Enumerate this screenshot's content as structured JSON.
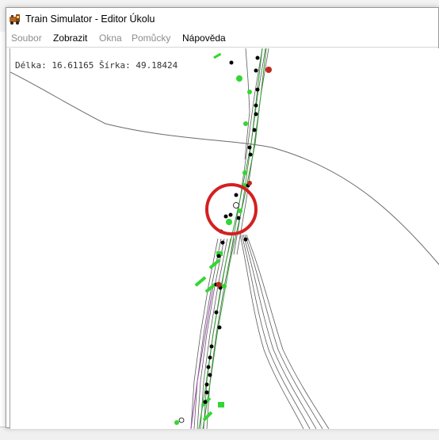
{
  "window": {
    "title": "Train Simulator - Editor Úkolu",
    "icon": "train-simulator-app-icon"
  },
  "menu": {
    "items": [
      {
        "label": "Soubor",
        "enabled": false
      },
      {
        "label": "Zobrazit",
        "enabled": true
      },
      {
        "label": "Okna",
        "enabled": false
      },
      {
        "label": "Pomůcky",
        "enabled": false
      },
      {
        "label": "Nápověda",
        "enabled": true
      }
    ]
  },
  "map": {
    "coordinates_text": "Délka: 16.61165 Šírka: 49.18424",
    "colors": {
      "track": "#5a5a5a",
      "route": "#2aa02a",
      "marker_green": "#33d633",
      "marker_black": "#000000",
      "marker_red": "#c0281e",
      "highlight_circle": "#d42020",
      "alt_route": "#a04ab0"
    }
  }
}
